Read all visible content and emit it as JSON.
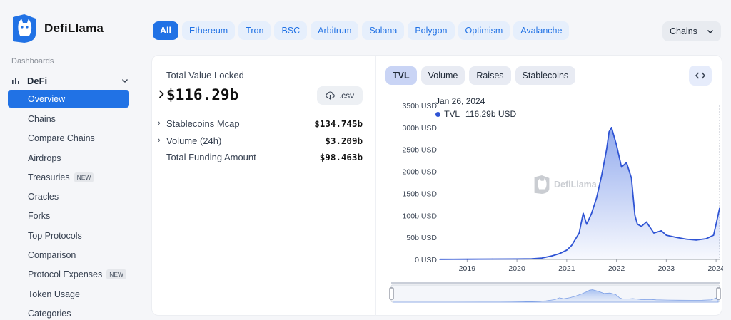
{
  "brand": {
    "name": "DefiLlama"
  },
  "sidebar": {
    "section_label": "Dashboards",
    "group_label": "DeFi",
    "items": [
      {
        "label": "Overview",
        "active": true,
        "badge": ""
      },
      {
        "label": "Chains",
        "badge": ""
      },
      {
        "label": "Compare Chains",
        "badge": ""
      },
      {
        "label": "Airdrops",
        "badge": ""
      },
      {
        "label": "Treasuries",
        "badge": "NEW"
      },
      {
        "label": "Oracles",
        "badge": ""
      },
      {
        "label": "Forks",
        "badge": ""
      },
      {
        "label": "Top Protocols",
        "badge": ""
      },
      {
        "label": "Comparison",
        "badge": ""
      },
      {
        "label": "Protocol Expenses",
        "badge": "NEW"
      },
      {
        "label": "Token Usage",
        "badge": ""
      },
      {
        "label": "Categories",
        "badge": ""
      }
    ]
  },
  "chains": {
    "pills": [
      "All",
      "Ethereum",
      "Tron",
      "BSC",
      "Arbitrum",
      "Solana",
      "Polygon",
      "Optimism",
      "Avalanche"
    ],
    "active": "All",
    "dropdown_label": "Chains"
  },
  "stats": {
    "tvl_label": "Total Value Locked",
    "tvl_value": "$116.29b",
    "csv_label": ".csv",
    "rows": [
      {
        "label": "Stablecoins Mcap",
        "value": "$134.745b",
        "expandable": true
      },
      {
        "label": "Volume (24h)",
        "value": "$3.209b",
        "expandable": true
      },
      {
        "label": "Total Funding Amount",
        "value": "$98.463b",
        "expandable": false
      }
    ]
  },
  "chart_tabs": {
    "tabs": [
      "TVL",
      "Volume",
      "Raises",
      "Stablecoins"
    ],
    "active": "TVL"
  },
  "tooltip": {
    "date": "Jan 26, 2024",
    "series": "TVL",
    "value": "116.29b USD"
  },
  "watermark": "DefiLlama",
  "colors": {
    "accent": "#2172e5",
    "line": "#2f54d4"
  },
  "chart_data": {
    "type": "area",
    "title": "",
    "xlabel": "",
    "ylabel": "",
    "series": [
      {
        "name": "TVL",
        "x": [
          2018.45,
          2019.0,
          2019.5,
          2020.0,
          2020.3,
          2020.5,
          2020.7,
          2020.85,
          2021.0,
          2021.1,
          2021.25,
          2021.33,
          2021.4,
          2021.5,
          2021.6,
          2021.7,
          2021.8,
          2021.85,
          2021.9,
          2022.0,
          2022.1,
          2022.2,
          2022.3,
          2022.37,
          2022.42,
          2022.5,
          2022.6,
          2022.75,
          2022.9,
          2023.0,
          2023.2,
          2023.4,
          2023.6,
          2023.8,
          2023.95,
          2024.0,
          2024.07
        ],
        "values": [
          0.3,
          0.5,
          0.8,
          1,
          1.5,
          3,
          8,
          13,
          21,
          32,
          60,
          105,
          80,
          105,
          140,
          190,
          250,
          290,
          300,
          260,
          210,
          220,
          185,
          100,
          80,
          75,
          85,
          60,
          65,
          55,
          50,
          46,
          44,
          47,
          55,
          80,
          116.29
        ]
      }
    ],
    "x_ticks": [
      "2019",
      "2020",
      "2021",
      "2022",
      "2023",
      "2024"
    ],
    "y_ticks": [
      "0 USD",
      "50b USD",
      "100b USD",
      "150b USD",
      "200b USD",
      "250b USD",
      "300b USD",
      "350b USD"
    ],
    "ylim": [
      0,
      350
    ],
    "xlim": [
      2018.45,
      2024.07
    ],
    "grid": false,
    "legend": "none"
  }
}
